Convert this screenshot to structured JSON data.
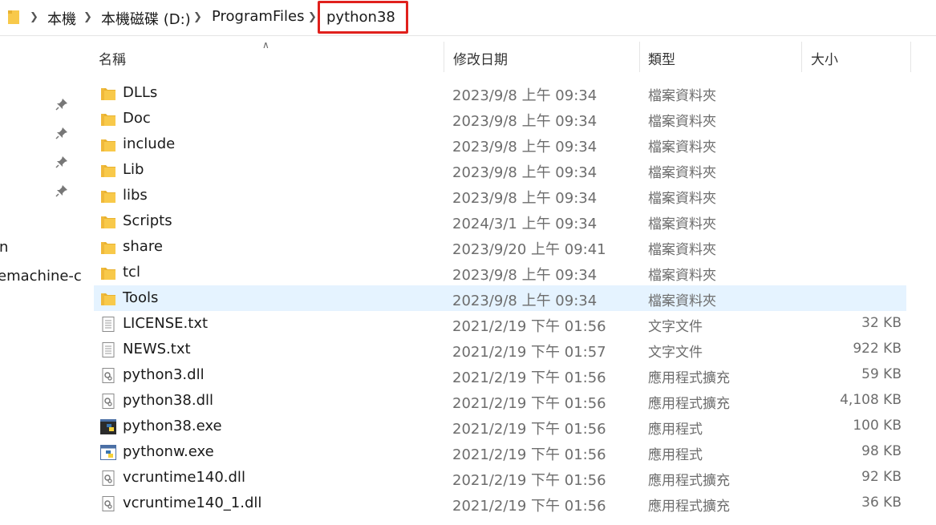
{
  "address_bar": {
    "crumbs": [
      "本機",
      "本機磁碟 (D:)",
      "ProgramFiles"
    ],
    "current": "python38"
  },
  "nav_pane": {
    "fragments": [
      "n",
      "emachine-c"
    ]
  },
  "columns": {
    "name": "名稱",
    "date": "修改日期",
    "type": "類型",
    "size": "大小"
  },
  "files": [
    {
      "name": "DLLs",
      "date": "2023/9/8 上午 09:34",
      "type": "檔案資料夾",
      "size": "",
      "icon": "folder-icon"
    },
    {
      "name": "Doc",
      "date": "2023/9/8 上午 09:34",
      "type": "檔案資料夾",
      "size": "",
      "icon": "folder-icon"
    },
    {
      "name": "include",
      "date": "2023/9/8 上午 09:34",
      "type": "檔案資料夾",
      "size": "",
      "icon": "folder-icon"
    },
    {
      "name": "Lib",
      "date": "2023/9/8 上午 09:34",
      "type": "檔案資料夾",
      "size": "",
      "icon": "folder-icon"
    },
    {
      "name": "libs",
      "date": "2023/9/8 上午 09:34",
      "type": "檔案資料夾",
      "size": "",
      "icon": "folder-icon"
    },
    {
      "name": "Scripts",
      "date": "2024/3/1 上午 09:34",
      "type": "檔案資料夾",
      "size": "",
      "icon": "folder-icon"
    },
    {
      "name": "share",
      "date": "2023/9/20 上午 09:41",
      "type": "檔案資料夾",
      "size": "",
      "icon": "folder-icon"
    },
    {
      "name": "tcl",
      "date": "2023/9/8 上午 09:34",
      "type": "檔案資料夾",
      "size": "",
      "icon": "folder-icon"
    },
    {
      "name": "Tools",
      "date": "2023/9/8 上午 09:34",
      "type": "檔案資料夾",
      "size": "",
      "icon": "folder-icon",
      "selected": true
    },
    {
      "name": "LICENSE.txt",
      "date": "2021/2/19 下午 01:56",
      "type": "文字文件",
      "size": "32 KB",
      "icon": "text-file-icon"
    },
    {
      "name": "NEWS.txt",
      "date": "2021/2/19 下午 01:57",
      "type": "文字文件",
      "size": "922 KB",
      "icon": "text-file-icon"
    },
    {
      "name": "python3.dll",
      "date": "2021/2/19 下午 01:56",
      "type": "應用程式擴充",
      "size": "59 KB",
      "icon": "dll-file-icon"
    },
    {
      "name": "python38.dll",
      "date": "2021/2/19 下午 01:56",
      "type": "應用程式擴充",
      "size": "4,108 KB",
      "icon": "dll-file-icon"
    },
    {
      "name": "python38.exe",
      "date": "2021/2/19 下午 01:56",
      "type": "應用程式",
      "size": "100 KB",
      "icon": "python-console-icon"
    },
    {
      "name": "pythonw.exe",
      "date": "2021/2/19 下午 01:56",
      "type": "應用程式",
      "size": "98 KB",
      "icon": "python-window-icon"
    },
    {
      "name": "vcruntime140.dll",
      "date": "2021/2/19 下午 01:56",
      "type": "應用程式擴充",
      "size": "92 KB",
      "icon": "dll-file-icon"
    },
    {
      "name": "vcruntime140_1.dll",
      "date": "2021/2/19 下午 01:56",
      "type": "應用程式擴充",
      "size": "36 KB",
      "icon": "dll-file-icon"
    }
  ],
  "colors": {
    "selected_row": "#e5f3ff",
    "highlight_box": "#e0201c",
    "folder": "#f8c94a"
  }
}
